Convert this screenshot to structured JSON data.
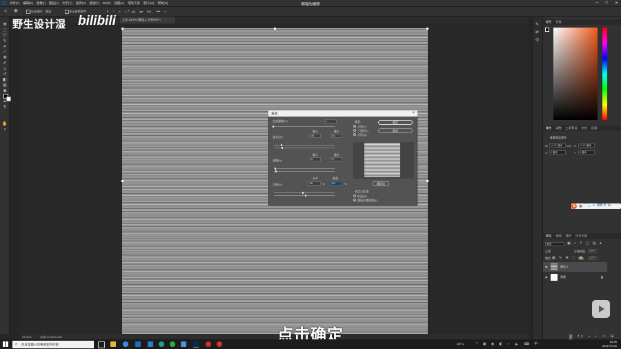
{
  "app": {
    "window_title": "啊我的眼睛",
    "menus": [
      "文件(F)",
      "编辑(E)",
      "图像(I)",
      "图层(L)",
      "文字(Y)",
      "选择(S)",
      "滤镜(T)",
      "3D(D)",
      "视图(V)",
      "增效工具",
      "窗口(W)",
      "帮助(H)"
    ],
    "window_controls": [
      "─",
      "□",
      "✕"
    ]
  },
  "options_bar": {
    "auto_select": "自动选择:",
    "layer": "图层",
    "show_transform": "显示变换控件",
    "more": "•••"
  },
  "document_tab": {
    "label": "上次 33.6% (图层1, 灰色/8#)",
    "close": "×"
  },
  "watermark": {
    "channel": "野生设计湿",
    "logo": "bilibili"
  },
  "status_bar": {
    "zoom": "33.56%",
    "doc_info": "文档:11.8M/11.8M"
  },
  "dialog": {
    "title": "波浪",
    "close": "×",
    "generators_label": "生成器数(G):",
    "generators_value": "1",
    "wavelength_label": "波长(W):",
    "wavelength_min_label": "最小",
    "wavelength_max_label": "最大",
    "wavelength_min": "145",
    "wavelength_max": "151",
    "amplitude_label": "波幅(A):",
    "amplitude_min_label": "最小",
    "amplitude_max_label": "最大",
    "amplitude_min": "49",
    "amplitude_max": "74",
    "scale_label": "比例(S):",
    "scale_h_label": "水平",
    "scale_v_label": "垂直",
    "scale_h": "88",
    "scale_v": "100",
    "percent": "%",
    "type_label": "类型:",
    "type_options": [
      "正弦(T)",
      "三角形(I)",
      "方形(Q)"
    ],
    "type_selected": 0,
    "ok_button": "确定",
    "cancel_button": "取消",
    "randomize_button": "随机化",
    "undefined_label": "未定义区域:",
    "wrap_around": "折回(R)",
    "repeat_edge": "重复边缘像素(E)",
    "undefined_selected": 1
  },
  "right_panels": {
    "color_tabs": [
      "颜色",
      "色板"
    ],
    "properties_tabs": [
      "属性",
      "调整",
      "工具预设",
      "字符",
      "段落"
    ],
    "properties_title": "像素图层属性",
    "w_label": "W",
    "w_value": "13.81 厘米",
    "h_label": "H",
    "h_value": "13.81 厘米",
    "x_label": "X",
    "x_value": "0 厘米",
    "y_label": "Y",
    "y_value": "0 厘米",
    "go_label": "GO",
    "layers_tabs": [
      "图层",
      "通道",
      "路径",
      "历史记录"
    ],
    "kind_filter": "类型",
    "blend_mode": "正常",
    "opacity_label": "不透明度:",
    "opacity_value": "100%",
    "lock_label": "锁定:",
    "fill_label": "填充:",
    "fill_value": "100%",
    "layers": [
      {
        "name": "图层 1",
        "selected": true
      },
      {
        "name": "背景",
        "selected": false
      }
    ]
  },
  "sogou": {
    "logo": "S",
    "label": "英"
  },
  "subtitle": "点击确定",
  "taskbar": {
    "search_placeholder": "在这里输入你要搜索的内容",
    "temp": "28°C",
    "time": "15:46",
    "date": "2022-04-22"
  },
  "colors": {
    "accent_blue": "#0b6ad6",
    "color_picker_hue": "#f25a1f",
    "dialog_bg": "#535353"
  }
}
